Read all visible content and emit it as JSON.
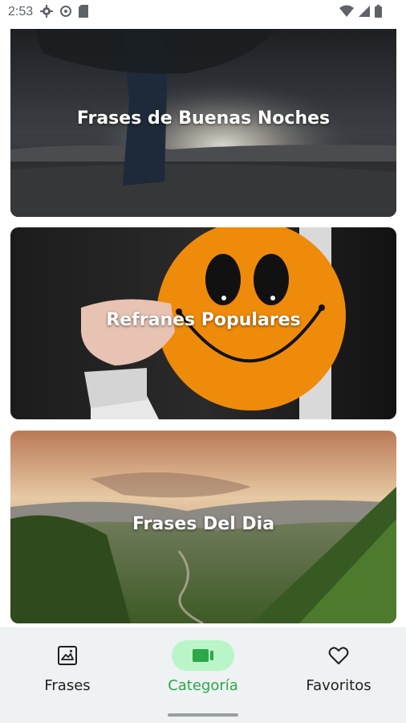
{
  "status_bar": {
    "time": "2:53",
    "icons_left": [
      "settings-icon",
      "gear-alt-icon",
      "sd-card-icon"
    ],
    "icons_right": [
      "wifi-icon",
      "signal-icon",
      "battery-icon"
    ]
  },
  "cards": [
    {
      "title": "Frases de Buenas Noches",
      "image": "night-tree-scene"
    },
    {
      "title": "Refranes Populares",
      "image": "smiley-face-hand-scene"
    },
    {
      "title": "Frases Del Dia",
      "image": "mountain-valley-sunset-scene"
    }
  ],
  "bottom_nav": {
    "items": [
      {
        "label": "Frases",
        "icon": "image-frame-icon",
        "active": false
      },
      {
        "label": "Categoría",
        "icon": "category-card-icon",
        "active": true
      },
      {
        "label": "Favoritos",
        "icon": "heart-icon",
        "active": false
      }
    ]
  },
  "colors": {
    "active_accent": "#2ca84a",
    "active_pill": "#b9f5c6",
    "nav_background": "#eef2f2"
  }
}
